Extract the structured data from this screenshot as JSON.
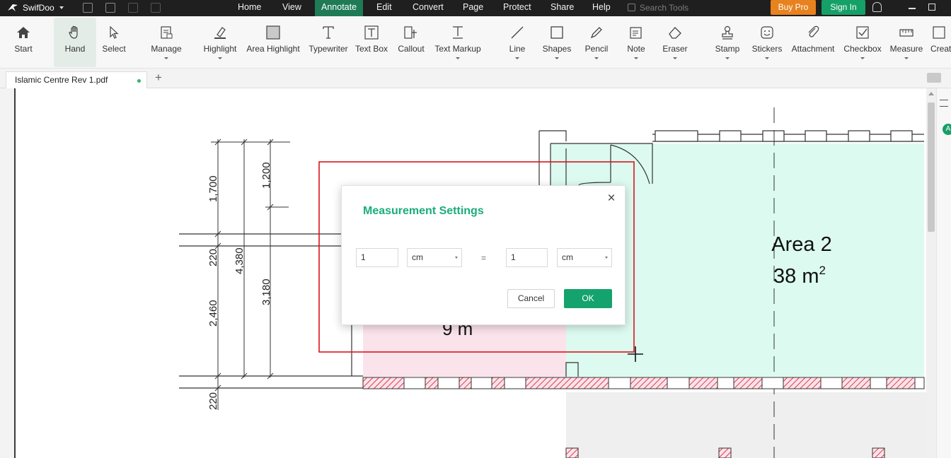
{
  "app": {
    "name": "SwifDoo"
  },
  "menu": {
    "items": [
      "Home",
      "View",
      "Annotate",
      "Edit",
      "Convert",
      "Page",
      "Protect",
      "Share",
      "Help"
    ],
    "active": "Annotate"
  },
  "search": {
    "placeholder": "Search Tools"
  },
  "header_buttons": {
    "buy_pro": "Buy Pro",
    "sign_in": "Sign In"
  },
  "toolbar": {
    "start": "Start",
    "hand": "Hand",
    "select": "Select",
    "manage": "Manage",
    "highlight": "Highlight",
    "area_highlight": "Area Highlight",
    "typewriter": "Typewriter",
    "text_box": "Text Box",
    "callout": "Callout",
    "text_markup": "Text Markup",
    "line": "Line",
    "shapes": "Shapes",
    "pencil": "Pencil",
    "note": "Note",
    "eraser": "Eraser",
    "stamp": "Stamp",
    "stickers": "Stickers",
    "attachment": "Attachment",
    "checkbox": "Checkbox",
    "measure": "Measure",
    "create": "Creat",
    "active_tool": "Hand"
  },
  "tabs": {
    "document": "Islamic Centre Rev 1.pdf",
    "add": "+"
  },
  "drawing": {
    "dimensions": {
      "d1700": "1,700",
      "d1200": "1,200",
      "d220a": "220",
      "d4380": "4,380",
      "d3180": "3,180",
      "d2460": "2,460",
      "d220b": "220"
    },
    "area2_label": "Area 2",
    "area2_value": "38 m",
    "area2_sup": "2",
    "area1_partial": "9 m",
    "colors": {
      "area_green": "#dcfaf0",
      "area_pink": "#fbe3ec",
      "selection_red": "#d9141c"
    }
  },
  "dialog": {
    "title": "Measurement Settings",
    "left_value": "1",
    "left_unit": "cm",
    "equals": "=",
    "right_value": "1",
    "right_unit": "cm",
    "cancel": "Cancel",
    "ok": "OK"
  },
  "right_panel": {
    "badge": "A"
  }
}
